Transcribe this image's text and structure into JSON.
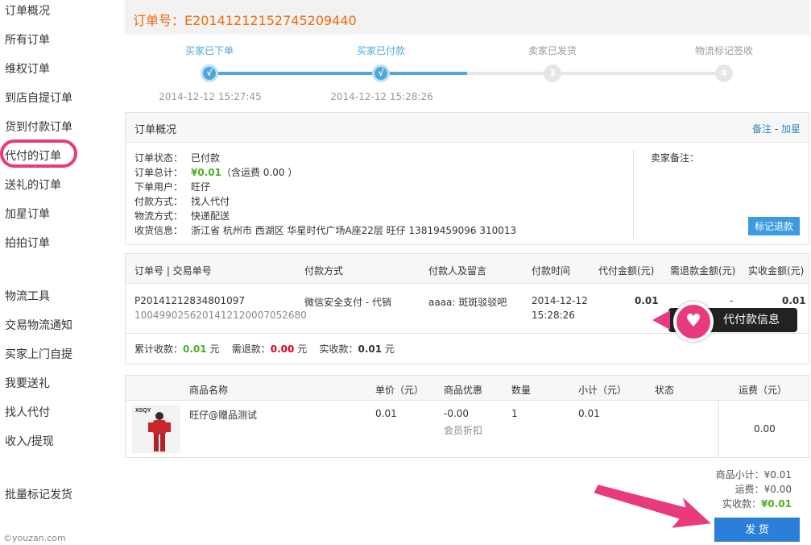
{
  "sidebar": {
    "items": [
      {
        "label": "订单概况"
      },
      {
        "label": "所有订单"
      },
      {
        "label": "维权订单"
      },
      {
        "label": "到店自提订单"
      },
      {
        "label": "货到付款订单"
      },
      {
        "label": "代付的订单"
      },
      {
        "label": "送礼的订单"
      },
      {
        "label": "加星订单"
      },
      {
        "label": "拍拍订单"
      },
      {
        "label": "物流工具"
      },
      {
        "label": "交易物流通知"
      },
      {
        "label": "买家上门自提"
      },
      {
        "label": "我要送礼"
      },
      {
        "label": "找人代付"
      },
      {
        "label": "收入/提现"
      },
      {
        "label": "批量标记发货"
      }
    ],
    "watermark": "©youzan.com"
  },
  "header": {
    "order_label": "订单号：",
    "order_no": "E20141212152745209440"
  },
  "progress": {
    "steps": [
      {
        "label": "买家已下单",
        "time": "2014-12-12 15:27:45",
        "mark": "√"
      },
      {
        "label": "买家已付款",
        "time": "2014-12-12 15:28:26",
        "mark": "√"
      },
      {
        "label": "卖家已发货",
        "time": "",
        "mark": "3"
      },
      {
        "label": "物流标记签收",
        "time": "",
        "mark": "4"
      }
    ]
  },
  "overview": {
    "title": "订单概况",
    "note_link": "备注",
    "sep": " - ",
    "star_link": "加星",
    "fields": [
      {
        "k": "订单状态：",
        "v": "已付款"
      },
      {
        "k": "订单总计：",
        "v": "¥0.01",
        "v2": "（含运费 0.00 ）"
      },
      {
        "k": "下单用户：",
        "v": "旺仔"
      },
      {
        "k": "付款方式：",
        "v": "找人代付"
      },
      {
        "k": "物流方式：",
        "v": "快递配送"
      },
      {
        "k": "收货信息：",
        "v": "浙江省 杭州市 西湖区 华星时代广场A座22层 旺仔 13819459096 310013"
      }
    ],
    "seller_note_label": "卖家备注：",
    "mark_refund": "标记退款"
  },
  "payments": {
    "headers": [
      "订单号 | 交易单号",
      "付款方式",
      "付款人及留言",
      "付款时间",
      "代付金额(元)",
      "需退款金额(元)",
      "实收金额(元)"
    ],
    "row": {
      "order_no": "P20141212834801097",
      "trade_no": "1004990256201412120007052680",
      "method": "微信安全支付 - 代销",
      "payer": "aaaa: 斑斑驳驳吧",
      "time1": "2014-12-12",
      "time2": "15:28:26",
      "amount": "0.01",
      "refund": "-",
      "received": "0.01"
    },
    "totals": {
      "sum_label": "累计收款：",
      "sum": "0.01",
      "unit": "元",
      "refund_label": "需退款：",
      "refund": "0.00",
      "received_label": "实收款：",
      "received": "0.01"
    }
  },
  "callout": {
    "text": "代付款信息",
    "icon": "heart-icon"
  },
  "products": {
    "headers": [
      "商品名称",
      "单价（元）",
      "商品优惠",
      "数量",
      "小计（元）",
      "状态",
      "运费（元）"
    ],
    "row": {
      "thumb_text": "XSQY",
      "name": "旺仔@赠品测试",
      "price": "0.01",
      "discount": "-0.00",
      "discount_note": "会员折扣",
      "qty": "1",
      "subtotal": "0.01",
      "status": "",
      "shipping": "0.00"
    }
  },
  "summary": {
    "goods_label": "商品小计：",
    "goods": "¥0.01",
    "ship_label": "运费：",
    "ship": "¥0.00",
    "received_label": "实收款：",
    "received": "¥0.01"
  },
  "ship_button": "发 货",
  "colors": {
    "accent": "#ea3a7e",
    "blue": "#2b7fd8",
    "orange": "#f06a0f",
    "green": "#4caf22"
  }
}
